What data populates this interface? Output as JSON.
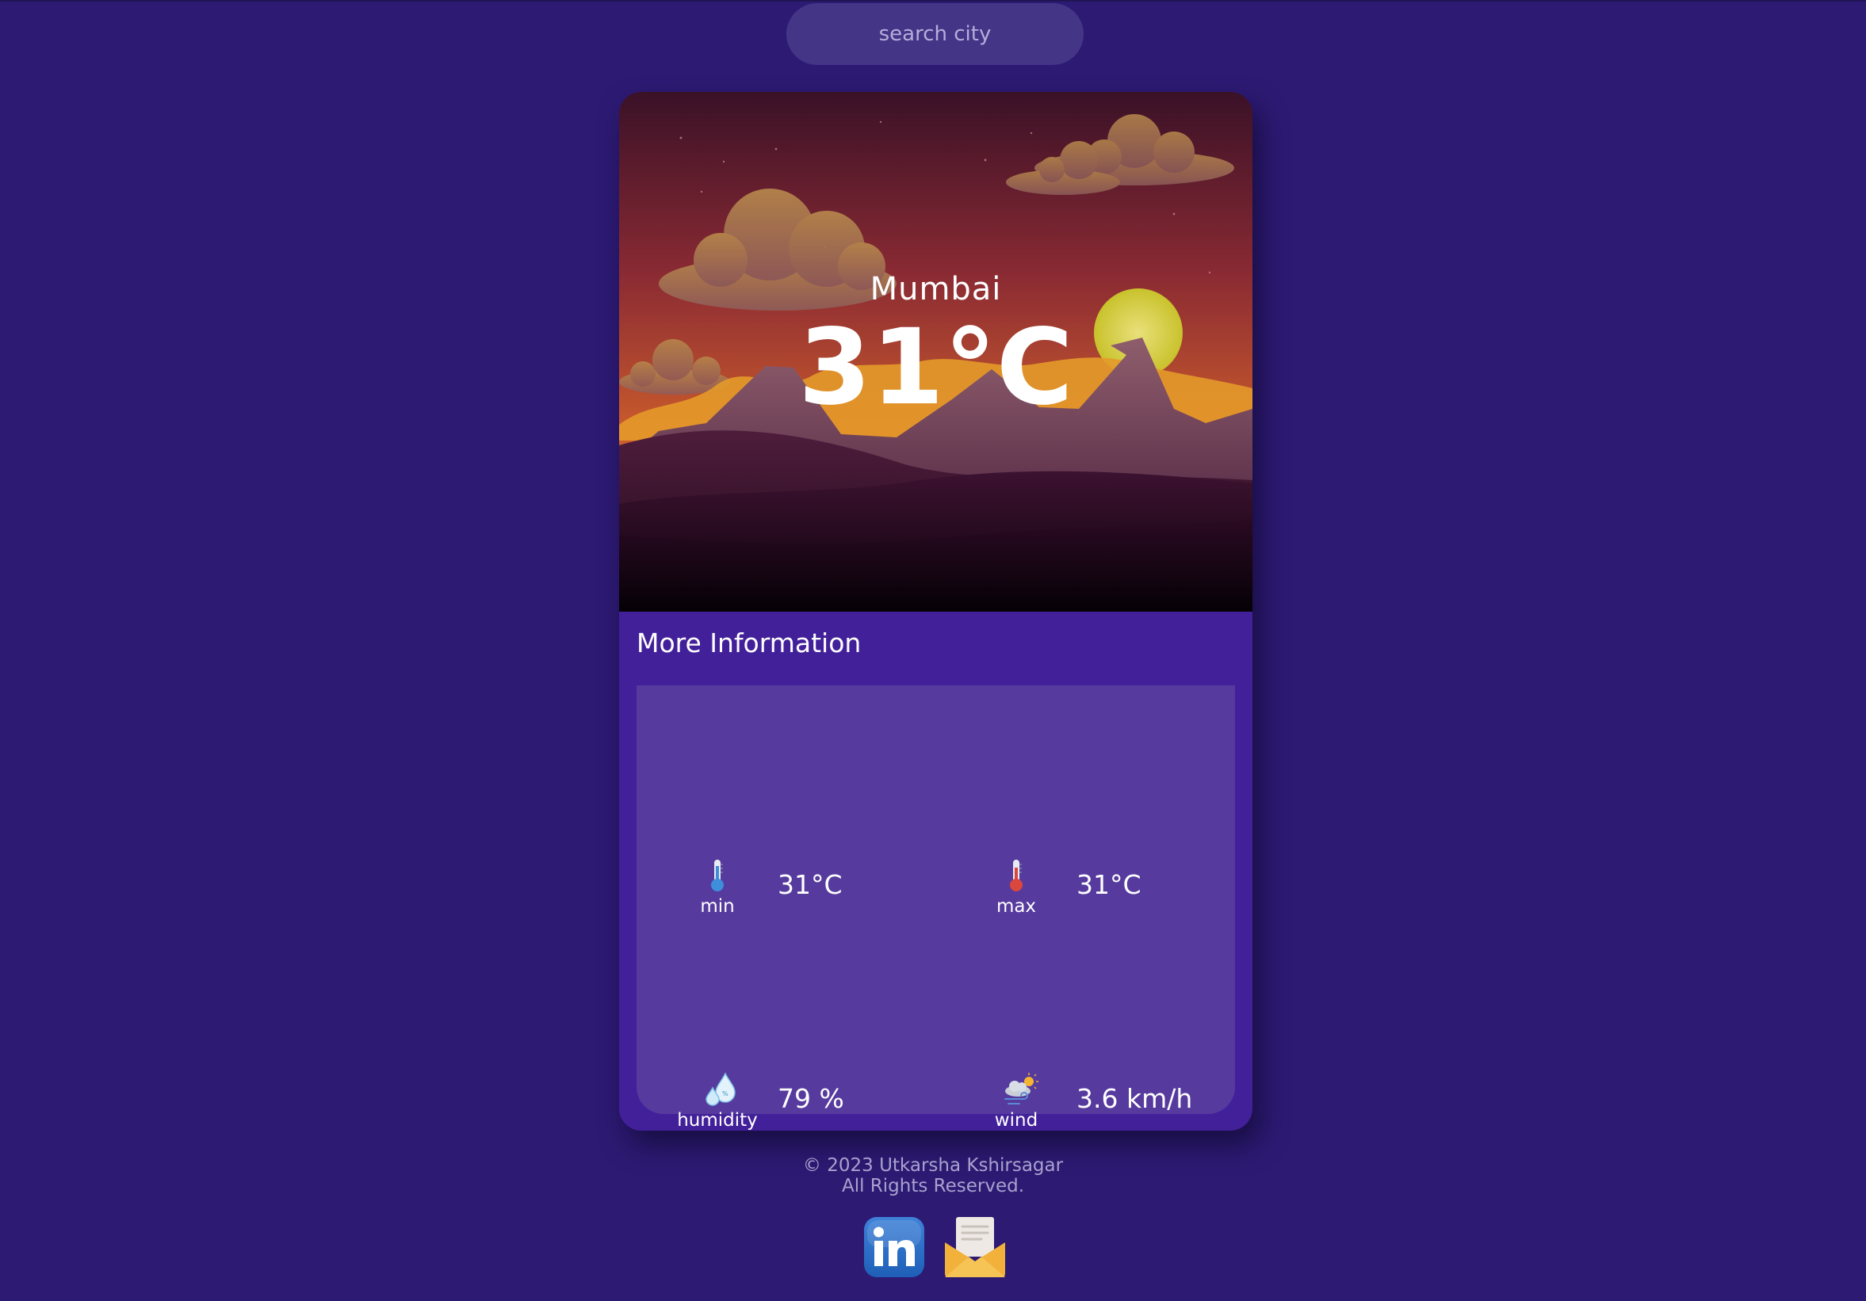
{
  "search": {
    "placeholder": "search city"
  },
  "card": {
    "city": "Mumbai",
    "temperature": "31°C",
    "more_info_title": "More Information",
    "items": [
      {
        "label": "min",
        "value": "31°C",
        "icon": "thermometer-cold-icon"
      },
      {
        "label": "max",
        "value": "31°C",
        "icon": "thermometer-hot-icon"
      },
      {
        "label": "humidity",
        "value": "79 %",
        "icon": "humidity-drops-icon"
      },
      {
        "label": "wind",
        "value": "3.6 km/h",
        "icon": "wind-cloud-icon"
      }
    ]
  },
  "footer": {
    "copyright": "© 2023 Utkarsha Kshirsagar",
    "rights": "All Rights Reserved."
  },
  "social": [
    {
      "icon": "linkedin-icon"
    },
    {
      "icon": "mail-icon"
    }
  ],
  "colors": {
    "background": "#2d1a73",
    "card": "#42209a",
    "panel": "#563a9e",
    "search": "#453587"
  }
}
